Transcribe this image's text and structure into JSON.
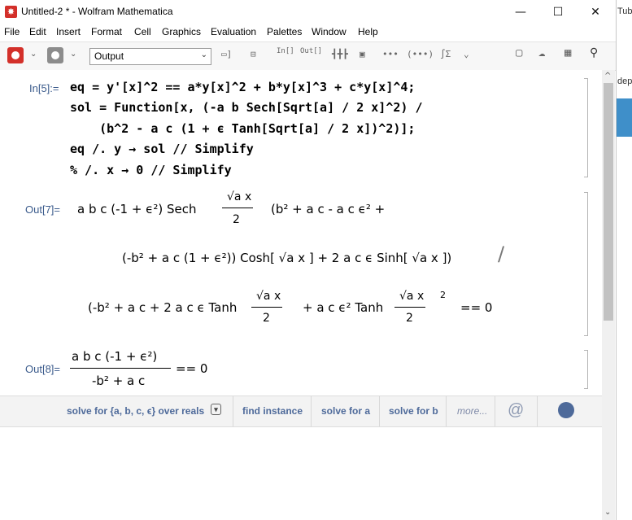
{
  "window": {
    "title": "Untitled-2 * - Wolfram Mathematica",
    "minimize_glyph": "—",
    "maximize_glyph": "☐",
    "close_glyph": "✕"
  },
  "menu": [
    "File",
    "Edit",
    "Insert",
    "Format",
    "Cell",
    "Graphics",
    "Evaluation",
    "Palettes",
    "Window",
    "Help"
  ],
  "toolbar": {
    "style_value": "Output",
    "icons": [
      "gear-icon",
      "settings-icon",
      "cell-bracket-icon",
      "input-template-icon",
      "output-template-icon",
      "inline-icon",
      "screenshot-icon",
      "ellipsis-icon",
      "integral-icon",
      "expand-icon",
      "comment-icon",
      "cloud-upload-icon",
      "keyboard-icon",
      "search-icon"
    ],
    "glyph_in": "In[]",
    "glyph_out": "Out[]",
    "glyph_dots": "•••",
    "glyph_bullets": "(•••)",
    "glyph_int": "∫Σ",
    "glyph_expand": "⌄⌄"
  },
  "notebook": {
    "in5_label": "In[5]:=",
    "in5_lines": [
      "eq = y'[x]^2 == a*y[x]^2 + b*y[x]^3 + c*y[x]^4;",
      "sol = Function[x, (-a b Sech[Sqrt[a] / 2 x]^2) /",
      "    (b^2 - a c (1 + ϵ Tanh[Sqrt[a] / 2 x])^2)];",
      "eq /. y → sol // Simplify",
      "% /. x → 0 // Simplify"
    ],
    "out7_label": "Out[7]=",
    "out7": {
      "line1_a": "a b c (-1 + ϵ²) Sech",
      "sqrt_a_x": "√a x",
      "two": "2",
      "line1_b": "(b² + a c - a c ϵ² +",
      "line2": "(-b² + a c (1 + ϵ²)) Cosh[ √a x ] + 2 a c ϵ Sinh[ √a x ])",
      "slash": "/",
      "line3_a": "(-b² + a c + 2 a c ϵ Tanh",
      "line3_b": "+ a c ϵ² Tanh",
      "sq": "2",
      "eq0": "== 0"
    },
    "out8_label": "Out[8]=",
    "out8": {
      "numer": "a b c (-1 + ϵ²)",
      "denom": "-b² + a c",
      "eq0": "== 0"
    }
  },
  "assistant": {
    "items": [
      "solve for {a, b, c, ϵ} over reals",
      "find instance",
      "solve for a",
      "solve for b",
      "more..."
    ],
    "dropdown_glyph": "▾"
  },
  "background_window": {
    "text1": "Tub",
    "text2": "dep",
    "accent": "#3f8fc9"
  },
  "colors": {
    "symbol_blue": "#1c2bd6",
    "label_blue": "#3b5b8c",
    "brand_red": "#d3302a"
  }
}
